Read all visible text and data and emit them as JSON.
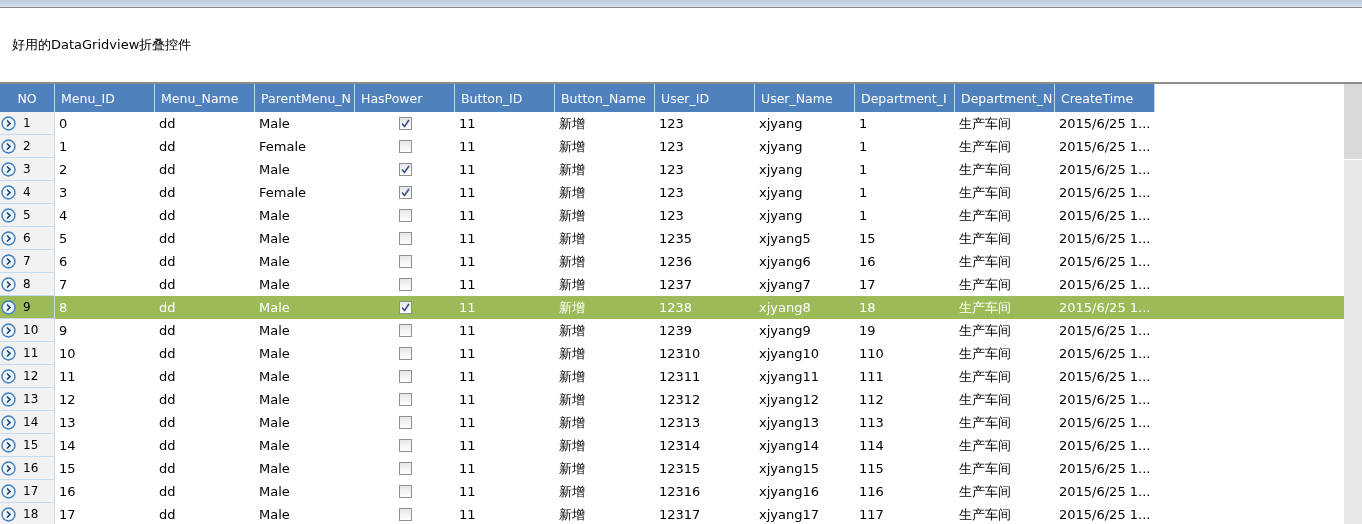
{
  "form": {
    "title": "好用的DataGridview折叠控件"
  },
  "grid": {
    "columns": [
      {
        "label": "NO",
        "kind": "rowheader"
      },
      {
        "label": "Menu_ID",
        "kind": "text"
      },
      {
        "label": "Menu_Name",
        "kind": "text"
      },
      {
        "label": "ParentMenu_N",
        "kind": "text"
      },
      {
        "label": "HasPower",
        "kind": "check"
      },
      {
        "label": "Button_ID",
        "kind": "text"
      },
      {
        "label": "Button_Name",
        "kind": "text"
      },
      {
        "label": "User_ID",
        "kind": "text"
      },
      {
        "label": "User_Name",
        "kind": "text"
      },
      {
        "label": "Department_I",
        "kind": "text"
      },
      {
        "label": "Department_N",
        "kind": "text"
      },
      {
        "label": "CreateTime",
        "kind": "text"
      }
    ],
    "rows": [
      {
        "no": "1",
        "values": [
          "0",
          "dd",
          "Male",
          "11",
          "新增",
          "123",
          "xjyang",
          "1",
          "生产车间",
          "2015/6/25 1..."
        ],
        "has_power": true,
        "selected": false
      },
      {
        "no": "2",
        "values": [
          "1",
          "dd",
          "Female",
          "11",
          "新增",
          "123",
          "xjyang",
          "1",
          "生产车间",
          "2015/6/25 1..."
        ],
        "has_power": false,
        "selected": false
      },
      {
        "no": "3",
        "values": [
          "2",
          "dd",
          "Male",
          "11",
          "新增",
          "123",
          "xjyang",
          "1",
          "生产车间",
          "2015/6/25 1..."
        ],
        "has_power": true,
        "selected": false
      },
      {
        "no": "4",
        "values": [
          "3",
          "dd",
          "Female",
          "11",
          "新增",
          "123",
          "xjyang",
          "1",
          "生产车间",
          "2015/6/25 1..."
        ],
        "has_power": true,
        "selected": false
      },
      {
        "no": "5",
        "values": [
          "4",
          "dd",
          "Male",
          "11",
          "新增",
          "123",
          "xjyang",
          "1",
          "生产车间",
          "2015/6/25 1..."
        ],
        "has_power": false,
        "selected": false
      },
      {
        "no": "6",
        "values": [
          "5",
          "dd",
          "Male",
          "11",
          "新增",
          "1235",
          "xjyang5",
          "15",
          "生产车间",
          "2015/6/25 1..."
        ],
        "has_power": false,
        "selected": false
      },
      {
        "no": "7",
        "values": [
          "6",
          "dd",
          "Male",
          "11",
          "新增",
          "1236",
          "xjyang6",
          "16",
          "生产车间",
          "2015/6/25 1..."
        ],
        "has_power": false,
        "selected": false
      },
      {
        "no": "8",
        "values": [
          "7",
          "dd",
          "Male",
          "11",
          "新增",
          "1237",
          "xjyang7",
          "17",
          "生产车间",
          "2015/6/25 1..."
        ],
        "has_power": false,
        "selected": false
      },
      {
        "no": "9",
        "values": [
          "8",
          "dd",
          "Male",
          "11",
          "新增",
          "1238",
          "xjyang8",
          "18",
          "生产车间",
          "2015/6/25 1..."
        ],
        "has_power": true,
        "selected": true
      },
      {
        "no": "10",
        "values": [
          "9",
          "dd",
          "Male",
          "11",
          "新增",
          "1239",
          "xjyang9",
          "19",
          "生产车间",
          "2015/6/25 1..."
        ],
        "has_power": false,
        "selected": false
      },
      {
        "no": "11",
        "values": [
          "10",
          "dd",
          "Male",
          "11",
          "新增",
          "12310",
          "xjyang10",
          "110",
          "生产车间",
          "2015/6/25 1..."
        ],
        "has_power": false,
        "selected": false
      },
      {
        "no": "12",
        "values": [
          "11",
          "dd",
          "Male",
          "11",
          "新增",
          "12311",
          "xjyang11",
          "111",
          "生产车间",
          "2015/6/25 1..."
        ],
        "has_power": false,
        "selected": false
      },
      {
        "no": "13",
        "values": [
          "12",
          "dd",
          "Male",
          "11",
          "新增",
          "12312",
          "xjyang12",
          "112",
          "生产车间",
          "2015/6/25 1..."
        ],
        "has_power": false,
        "selected": false
      },
      {
        "no": "14",
        "values": [
          "13",
          "dd",
          "Male",
          "11",
          "新增",
          "12313",
          "xjyang13",
          "113",
          "生产车间",
          "2015/6/25 1..."
        ],
        "has_power": false,
        "selected": false
      },
      {
        "no": "15",
        "values": [
          "14",
          "dd",
          "Male",
          "11",
          "新增",
          "12314",
          "xjyang14",
          "114",
          "生产车间",
          "2015/6/25 1..."
        ],
        "has_power": false,
        "selected": false
      },
      {
        "no": "16",
        "values": [
          "15",
          "dd",
          "Male",
          "11",
          "新增",
          "12315",
          "xjyang15",
          "115",
          "生产车间",
          "2015/6/25 1..."
        ],
        "has_power": false,
        "selected": false
      },
      {
        "no": "17",
        "values": [
          "16",
          "dd",
          "Male",
          "11",
          "新增",
          "12316",
          "xjyang16",
          "116",
          "生产车间",
          "2015/6/25 1..."
        ],
        "has_power": false,
        "selected": false
      },
      {
        "no": "18",
        "values": [
          "17",
          "dd",
          "Male",
          "11",
          "新增",
          "12317",
          "xjyang17",
          "117",
          "生产车间",
          "2015/6/25 1..."
        ],
        "has_power": false,
        "selected": false
      }
    ]
  }
}
